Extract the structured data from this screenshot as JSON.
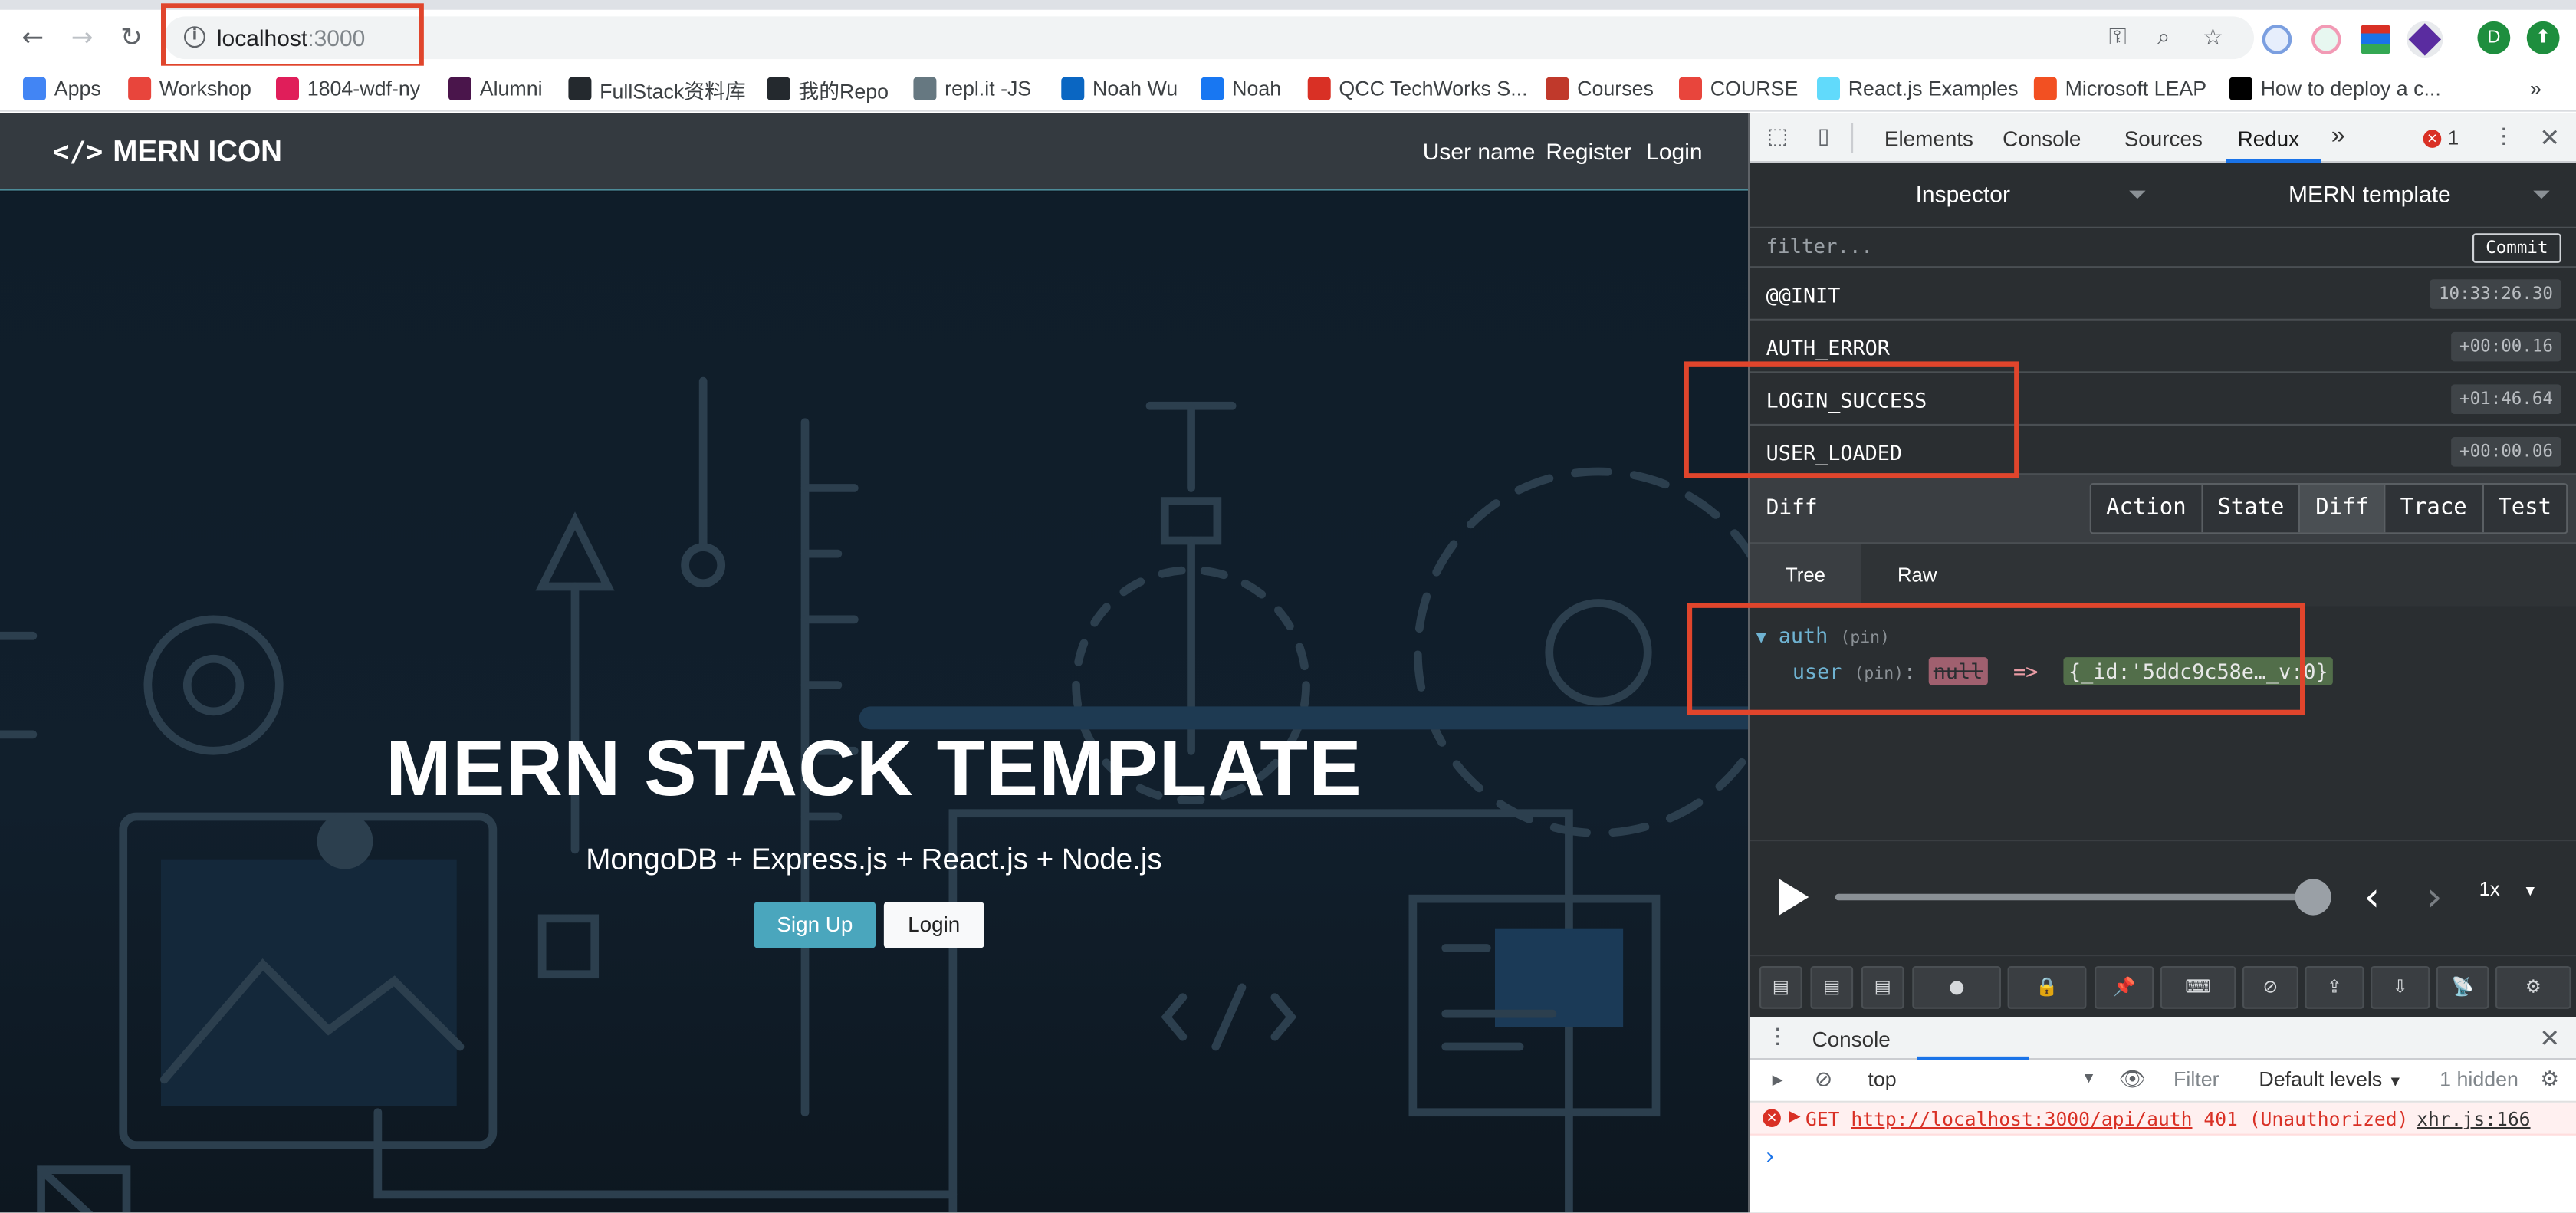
{
  "browser": {
    "url_host": "localhost",
    "url_port": ":3000",
    "avatar_letter": "D"
  },
  "bookmarks": [
    {
      "label": "Apps",
      "color": "#4285f4"
    },
    {
      "label": "Workshop",
      "color": "#e8453c"
    },
    {
      "label": "1804-wdf-ny",
      "color": "#e01e5a"
    },
    {
      "label": "Alumni",
      "color": "#4a154b"
    },
    {
      "label": "FullStack资料库",
      "color": "#24292e"
    },
    {
      "label": "我的Repo",
      "color": "#24292e"
    },
    {
      "label": "repl.it -JS",
      "color": "#667881"
    },
    {
      "label": "Noah Wu",
      "color": "#0a66c2"
    },
    {
      "label": "Noah",
      "color": "#1877f2"
    },
    {
      "label": "QCC TechWorks S...",
      "color": "#d93025"
    },
    {
      "label": "Courses",
      "color": "#c0392b"
    },
    {
      "label": "COURSE",
      "color": "#e8453c"
    },
    {
      "label": "React.js Examples",
      "color": "#61dafb"
    },
    {
      "label": "Microsoft LEAP",
      "color": "#f25022"
    },
    {
      "label": "How to deploy a c...",
      "color": "#000000"
    }
  ],
  "site": {
    "brand": "MERN ICON",
    "nav": [
      "User name",
      "Register",
      "Login"
    ],
    "hero_title": "MERN STACK TEMPLATE",
    "hero_subtitle": "MongoDB + Express.js + React.js + Node.js",
    "signup_label": "Sign Up",
    "login_label": "Login"
  },
  "devtools": {
    "tabs": [
      "Elements",
      "Console",
      "Sources",
      "Redux"
    ],
    "active_tab": "Redux",
    "more": "»",
    "error_count": "1"
  },
  "redux": {
    "inspector_label": "Inspector",
    "instance_label": "MERN template",
    "filter_placeholder": "filter...",
    "commit_label": "Commit",
    "actions": [
      {
        "name": "@@INIT",
        "time": "10:33:26.30"
      },
      {
        "name": "AUTH_ERROR",
        "time": "+00:00.16"
      },
      {
        "name": "LOGIN_SUCCESS",
        "time": "+01:46.64"
      },
      {
        "name": "USER_LOADED",
        "time": "+00:00.06"
      }
    ],
    "diff_title": "Diff",
    "monitor_tabs": [
      "Action",
      "State",
      "Diff",
      "Trace",
      "Test"
    ],
    "active_monitor": "Diff",
    "view_tabs": [
      "Tree",
      "Raw"
    ],
    "tree": {
      "root_key": "auth",
      "pin": "(pin)",
      "child_key": "user",
      "old_value": "null",
      "arrow": "=>",
      "new_value": "{_id:'5ddc9c58e…_v:0}"
    },
    "speed": "1x"
  },
  "console": {
    "title": "Console",
    "context": "top",
    "filter_placeholder": "Filter",
    "levels": "Default levels",
    "hidden": "1 hidden",
    "error_method": "GET",
    "error_url": "http://localhost:3000/api/auth",
    "error_status": "401 (Unauthorized)",
    "error_source": "xhr.js:166",
    "prompt": "›"
  },
  "colors": {
    "highlight": "#e0452c",
    "signup": "#4aa6bd",
    "redux_bg": "#2a2e31"
  }
}
